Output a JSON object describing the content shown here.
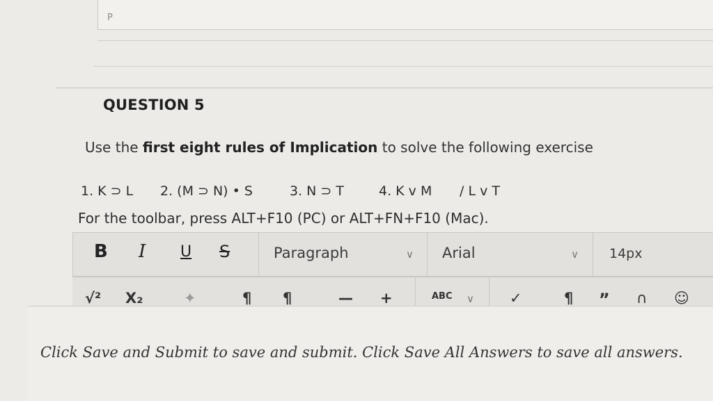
{
  "top_field": {
    "label": "P"
  },
  "question": {
    "title": "QUESTION 5",
    "instruction_before": "Use the ",
    "instruction_bold": "first eight rules of Implication",
    "instruction_after": " to solve the following exercise",
    "premises": [
      "1. K ⊃ L",
      "2. (M ⊃ N) • S",
      "3. N ⊃ T",
      "4. K v M",
      "/ L v T"
    ],
    "toolbar_hint": "For the toolbar, press ALT+F10 (PC) or ALT+FN+F10 (Mac)."
  },
  "toolbar": {
    "bold": "B",
    "italic": "I",
    "underline": "U",
    "strike": "S",
    "format": "Paragraph",
    "font": "Arial",
    "size": "14px",
    "row2": {
      "superscript": "√²",
      "subscript": "X₂",
      "pilcrow_ltr": "¶",
      "pilcrow_rtl": "¶",
      "hr": "—",
      "plus": "+",
      "spellcheck": "ABC",
      "show_blocks": "¶",
      "quote": "”"
    }
  },
  "footer_note": "Click Save and Submit to save and submit. Click Save All Answers to save all answers."
}
